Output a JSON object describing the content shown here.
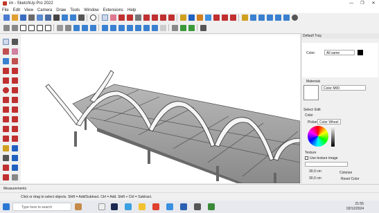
{
  "window": {
    "title": "im - SketchUp Pro 2022",
    "controls": [
      "—",
      "❐",
      "✕"
    ]
  },
  "menu": [
    "File",
    "Edit",
    "View",
    "Camera",
    "Draw",
    "Tools",
    "Window",
    "Extensions",
    "Help"
  ],
  "tray": {
    "title": "Default Tray",
    "color_label": "Color:",
    "color_select": "All same",
    "materials_title": "Materials",
    "material_name": "Color M00",
    "tab_select": "Select",
    "tab_edit": "Edit",
    "color_heading": "Color",
    "picker_label": "Picker:",
    "picker_value": "Color Wheel",
    "texture_heading": "Texture",
    "use_texture": "Use texture image",
    "tex_w": "30,0 cm",
    "tex_h": "30,0 cm",
    "colorize": "Colorize",
    "reset_color": "Reset Color"
  },
  "measurements": {
    "label": "Measurements"
  },
  "status": {
    "message": "Click or drag to select objects. Shift = Add/Subtract. Ctrl = Add. Shift + Ctrl = Subtract."
  },
  "taskbar": {
    "search_placeholder": "Type here to search",
    "time": "21:55",
    "date": "02/12/2024"
  },
  "colors": {
    "accent": "#1e6fd9",
    "swatch": "#000000"
  }
}
